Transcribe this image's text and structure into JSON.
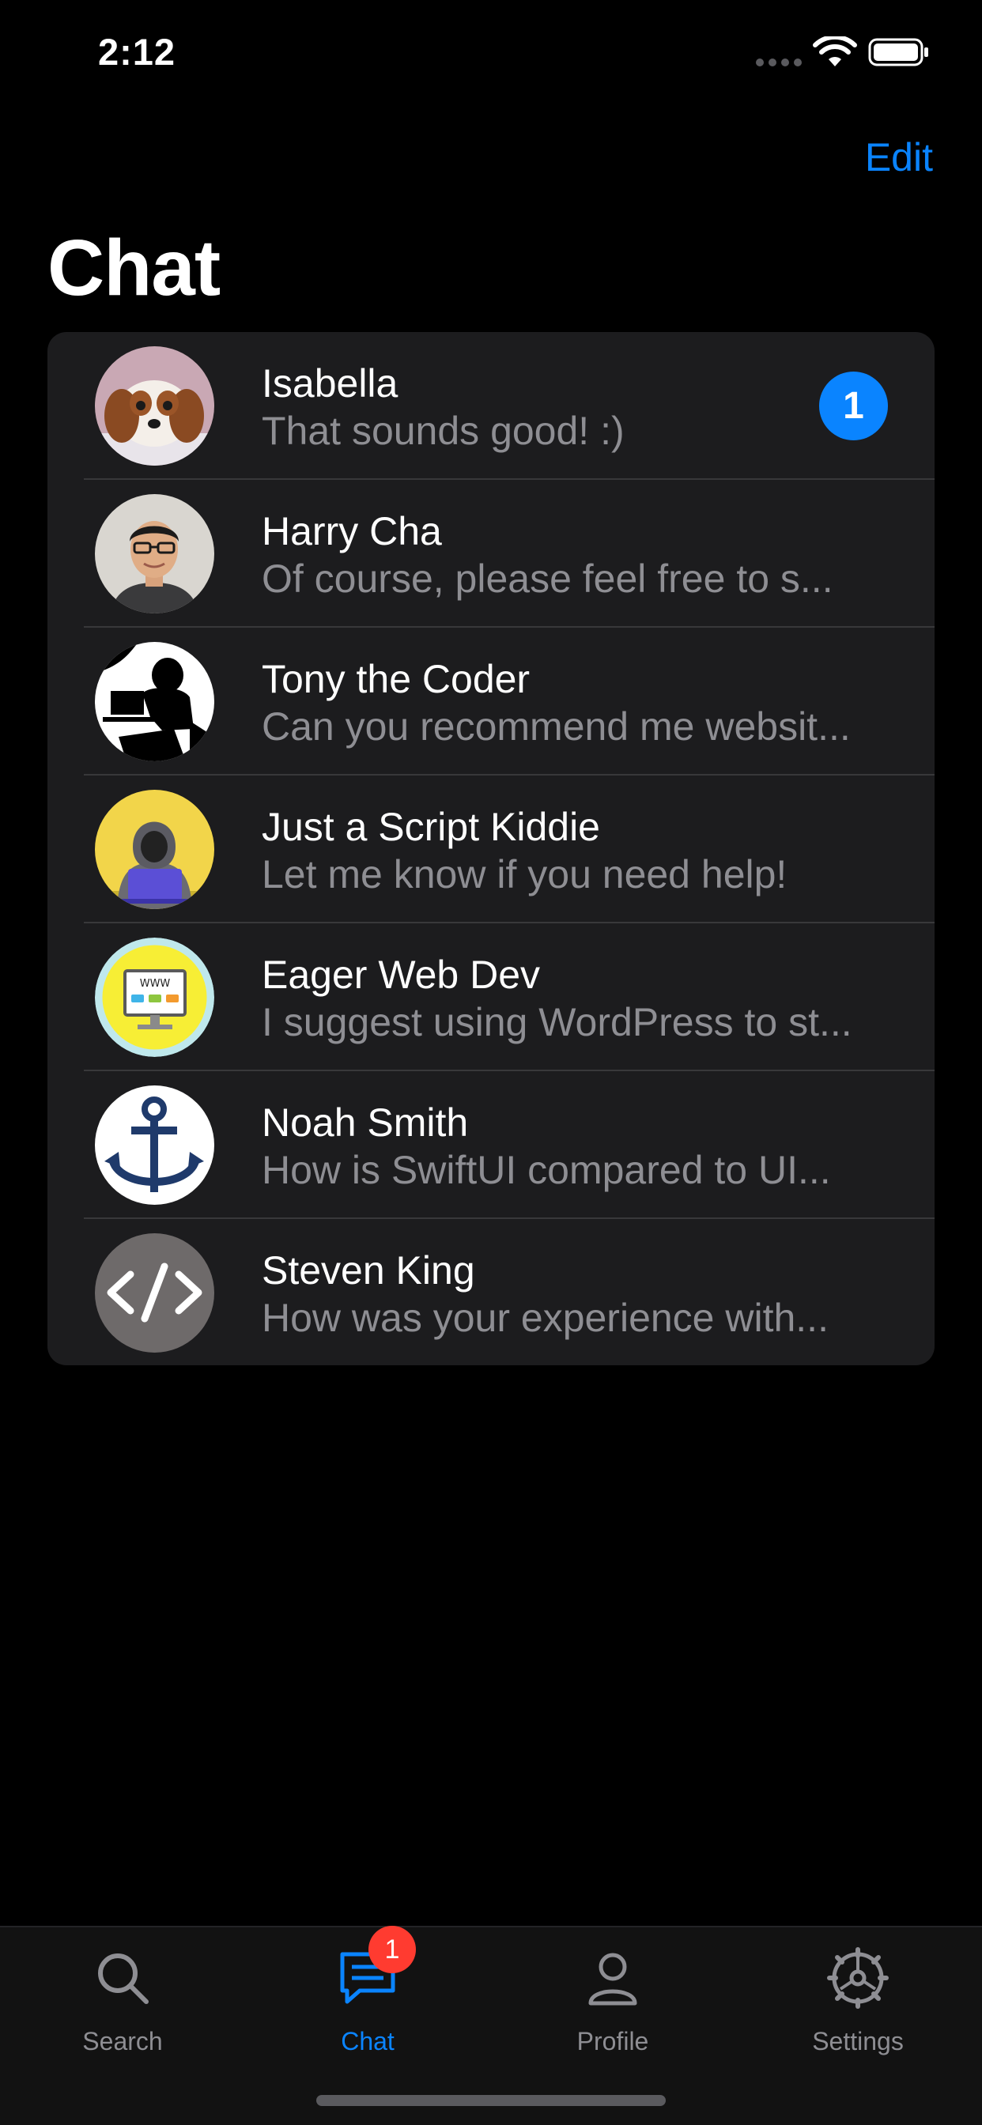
{
  "status_bar": {
    "time": "2:12"
  },
  "nav": {
    "edit_label": "Edit",
    "title": "Chat"
  },
  "chats": [
    {
      "name": "Isabella",
      "preview": "That sounds good!  :)",
      "unread": "1",
      "avatar": "puppy-avatar"
    },
    {
      "name": "Harry Cha",
      "preview": "Of course, please feel free to s...",
      "avatar": "person-photo-avatar"
    },
    {
      "name": "Tony the Coder",
      "preview": "Can you recommend me websit...",
      "avatar": "coder-silhouette-avatar"
    },
    {
      "name": "Just a Script Kiddie",
      "preview": "Let me know if you need help!",
      "avatar": "hacker-hoodie-avatar"
    },
    {
      "name": "Eager Web Dev",
      "preview": "I suggest using WordPress to st...",
      "avatar": "www-monitor-avatar"
    },
    {
      "name": "Noah Smith",
      "preview": "How is SwiftUI compared to UI...",
      "avatar": "anchor-avatar"
    },
    {
      "name": "Steven King",
      "preview": "How was your experience with...",
      "avatar": "code-tag-avatar"
    }
  ],
  "avatar_labels": {
    "www": "WWW"
  },
  "tabs": [
    {
      "label": "Search",
      "icon": "search-icon"
    },
    {
      "label": "Chat",
      "icon": "chat-bubble-icon",
      "badge": "1",
      "active": true
    },
    {
      "label": "Profile",
      "icon": "person-icon"
    },
    {
      "label": "Settings",
      "icon": "gear-icon"
    }
  ],
  "colors": {
    "accent": "#0a84ff",
    "badge_red": "#ff3b30",
    "list_bg": "#1c1c1e",
    "secondary_text": "#8e8e93"
  }
}
